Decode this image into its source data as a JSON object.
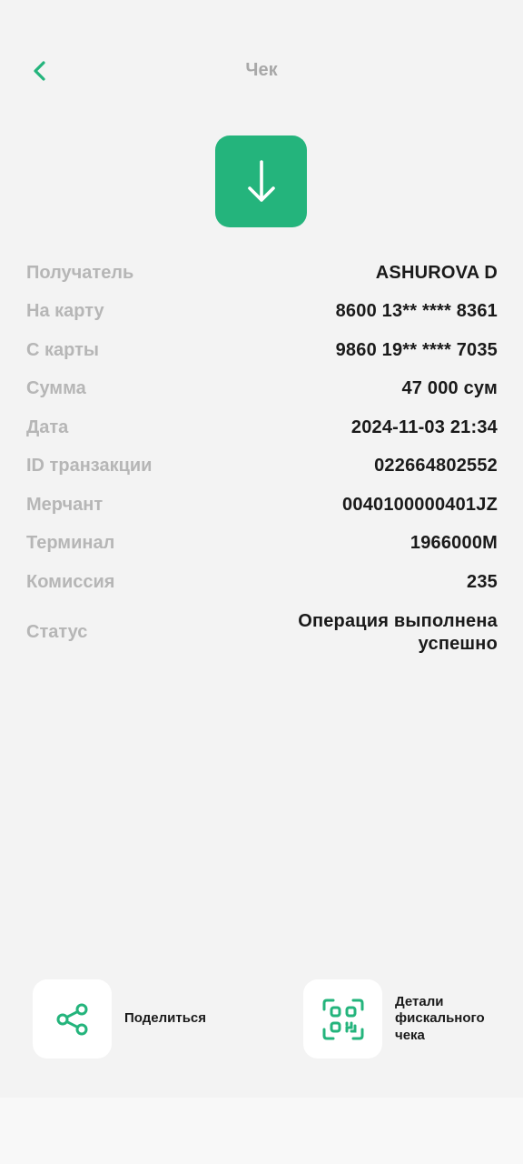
{
  "header": {
    "title": "Чек",
    "back_icon": "chevron-left-icon"
  },
  "hero": {
    "icon": "arrow-down-icon",
    "color": "#24b47c"
  },
  "details": [
    {
      "label": "Получатель",
      "value": "ASHUROVA D"
    },
    {
      "label": "На карту",
      "value": "8600 13** **** 8361"
    },
    {
      "label": "С карты",
      "value": "9860 19** **** 7035"
    },
    {
      "label": "Сумма",
      "value": "47 000 сум"
    },
    {
      "label": "Дата",
      "value": "2024-11-03 21:34"
    },
    {
      "label": "ID транзакции",
      "value": "022664802552"
    },
    {
      "label": "Мерчант",
      "value": "0040100000401JZ"
    },
    {
      "label": "Терминал",
      "value": "1966000M"
    },
    {
      "label": "Комиссия",
      "value": "235"
    },
    {
      "label": "Статус",
      "value": "Операция выполнена успешно"
    }
  ],
  "actions": {
    "share": {
      "label": "Поделиться",
      "icon": "share-icon"
    },
    "fiscal": {
      "label": "Детали фискального чека",
      "icon": "qr-scan-icon"
    }
  },
  "colors": {
    "accent": "#24b47c",
    "background": "#f3f3f3"
  }
}
